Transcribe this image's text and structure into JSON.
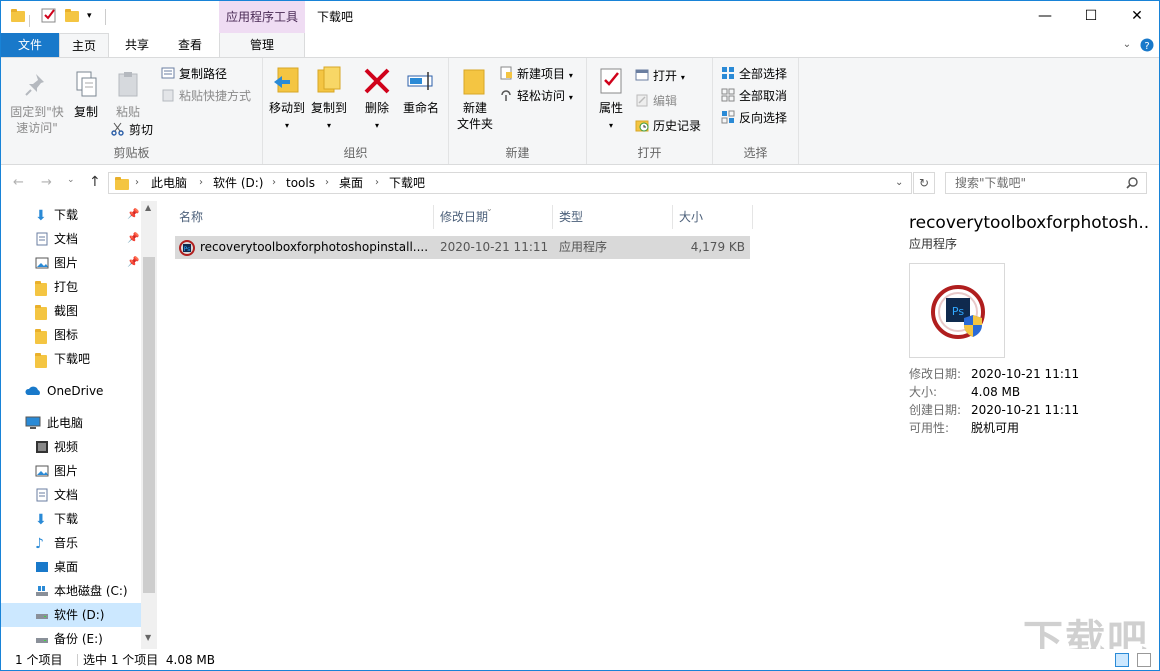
{
  "titlebar": {
    "context_tools": "应用程序工具",
    "title": "下载吧",
    "min": "—",
    "max": "☐",
    "close": "✕"
  },
  "tabs": {
    "file": "文件",
    "home": "主页",
    "share": "共享",
    "view": "查看",
    "manage": "管理"
  },
  "ribbon": {
    "clipboard": {
      "pin": "固定到\"快速访问\"",
      "pin_l1": "固定到\"快",
      "pin_l2": "速访问\"",
      "copy": "复制",
      "paste": "粘贴",
      "copy_path": "复制路径",
      "paste_shortcut": "粘贴快捷方式",
      "cut": "剪切",
      "label": "剪贴板"
    },
    "organize": {
      "move_to": "移动到",
      "copy_to": "复制到",
      "delete": "删除",
      "rename": "重命名",
      "label": "组织"
    },
    "new": {
      "new_folder_l1": "新建",
      "new_folder_l2": "文件夹",
      "new_item": "新建项目",
      "easy_access": "轻松访问",
      "label": "新建"
    },
    "open": {
      "properties": "属性",
      "open": "打开",
      "edit": "编辑",
      "history": "历史记录",
      "label": "打开"
    },
    "select": {
      "select_all": "全部选择",
      "select_none": "全部取消",
      "invert": "反向选择",
      "label": "选择"
    }
  },
  "address": {
    "crumbs": [
      "此电脑",
      "软件 (D:)",
      "tools",
      "桌面",
      "下载吧"
    ],
    "search_placeholder": "搜索\"下载吧\""
  },
  "nav": {
    "quick": [
      {
        "label": "下载",
        "pinned": true
      },
      {
        "label": "文档",
        "pinned": true
      },
      {
        "label": "图片",
        "pinned": true
      },
      {
        "label": "打包"
      },
      {
        "label": "截图"
      },
      {
        "label": "图标"
      },
      {
        "label": "下载吧"
      }
    ],
    "onedrive": "OneDrive",
    "pc": "此电脑",
    "pc_items": [
      "视频",
      "图片",
      "文档",
      "下载",
      "音乐",
      "桌面",
      "本地磁盘 (C:)",
      "软件 (D:)",
      "备份 (E:)"
    ]
  },
  "columns": {
    "name": "名称",
    "date": "修改日期",
    "type": "类型",
    "size": "大小"
  },
  "files": [
    {
      "name": "recoverytoolboxforphotoshopinstall....",
      "date": "2020-10-21 11:11",
      "type": "应用程序",
      "size": "4,179 KB"
    }
  ],
  "preview": {
    "title": "recoverytoolboxforphotosh...",
    "type": "应用程序",
    "modified_k": "修改日期:",
    "modified_v": "2020-10-21 11:11",
    "size_k": "大小:",
    "size_v": "4.08 MB",
    "created_k": "创建日期:",
    "created_v": "2020-10-21 11:11",
    "avail_k": "可用性:",
    "avail_v": "脱机可用"
  },
  "status": {
    "count": "1 个项目",
    "selected": "选中 1 个项目  4.08 MB"
  },
  "watermark": "下载吧",
  "colors": {
    "accent": "#1979ca",
    "folder": "#f4c542",
    "delete": "#d0021b",
    "selection": "#d9d9d9"
  }
}
